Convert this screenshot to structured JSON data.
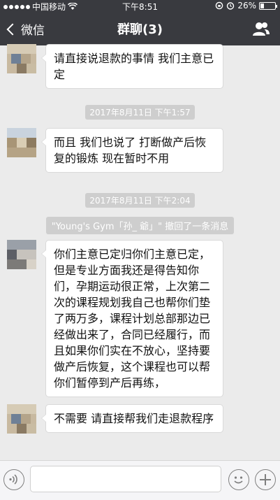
{
  "status_bar": {
    "carrier": "中国移动",
    "time": "下午8:51",
    "battery_text": "26%",
    "battery_level": 0.26
  },
  "nav": {
    "back_label": "微信",
    "title": "群聊(3)"
  },
  "messages": [
    {
      "text": "请直接说退款的事情 我们主意已定"
    },
    {
      "timestamp": "2017年8月11日 下午1:57"
    },
    {
      "text": "而且 我们也说了 打断做产后恢复的锻炼 现在暂时不用"
    },
    {
      "timestamp": "2017年8月11日 下午2:04"
    },
    {
      "system": "\"Young's Gym「孙_ 爺」\" 撤回了一条消息"
    },
    {
      "text": "你们主意已定归你们主意已定，但是专业方面我还是得告知你们，孕期运动很正常，上次第二次的课程规划我自己也帮你们垫了两万多，课程计划总部那边已经做出来了，合同已经履行，而且如果你们实在不放心，坚持要做产后恢复，这个课程也可以帮你们暂停到产后再练，"
    },
    {
      "text": "不需要 请直接帮我们走退款程序"
    }
  ],
  "input": {
    "value": ""
  },
  "icons": {
    "back": "chevron-left-icon",
    "people": "group-icon",
    "voice": "voice-icon",
    "emoji": "emoji-icon",
    "plus": "plus-icon"
  }
}
